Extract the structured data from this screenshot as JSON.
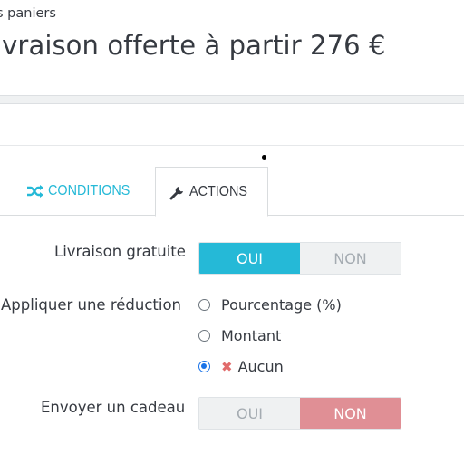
{
  "header": {
    "breadcrumb": "s paniers",
    "title": "ivraison offerte à partir 276 €"
  },
  "tabs": [
    {
      "label": "CONDITIONS",
      "icon": "shuffle-icon",
      "active": false
    },
    {
      "label": "ACTIONS",
      "icon": "wrench-icon",
      "active": true
    }
  ],
  "form": {
    "free_shipping": {
      "label": "Livraison gratuite",
      "yes": "OUI",
      "no": "NON",
      "value": "OUI"
    },
    "discount": {
      "label": "Appliquer une réduction",
      "options": [
        {
          "label": "Pourcentage (%)",
          "checked": false
        },
        {
          "label": "Montant",
          "checked": false
        },
        {
          "label": "Aucun",
          "checked": true,
          "icon": "x-icon"
        }
      ]
    },
    "gift": {
      "label": "Envoyer un cadeau",
      "yes": "OUI",
      "no": "NON",
      "value": "NON"
    }
  },
  "colors": {
    "accent": "#25b9d7",
    "no_active": "#e08f95",
    "text": "#363a41",
    "remove_icon": "#e16c6c"
  }
}
